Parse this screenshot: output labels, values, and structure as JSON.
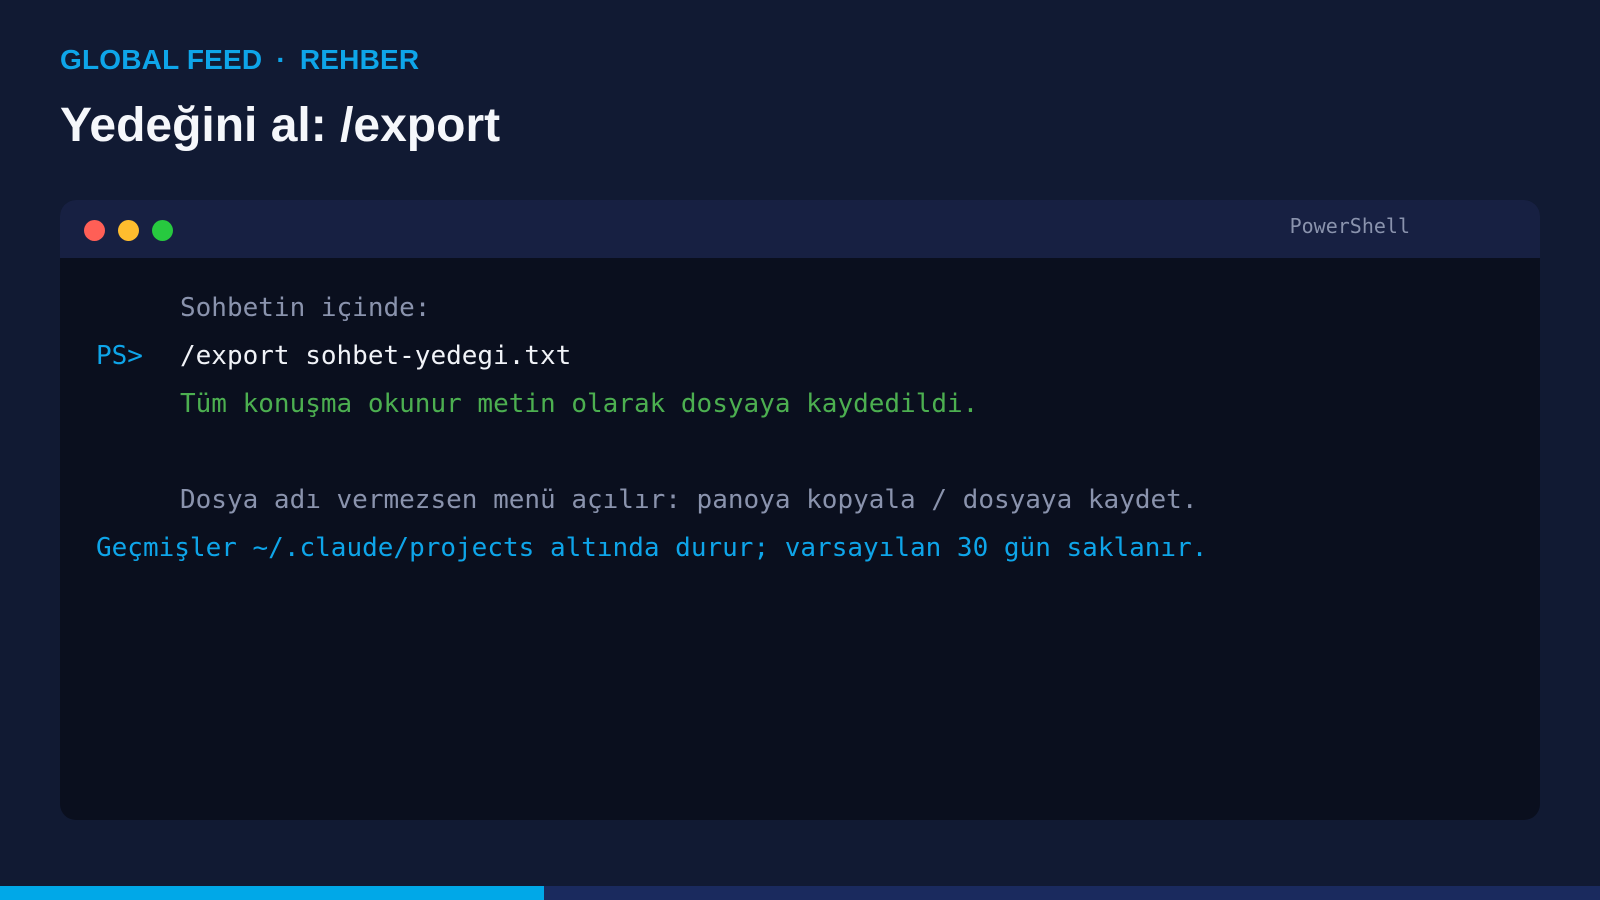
{
  "header": {
    "section": "GLOBAL FEED",
    "separator": "·",
    "category": "REHBER",
    "title": "Yedeğini al: /export"
  },
  "terminal": {
    "title": "PowerShell",
    "prompt": "PS>",
    "lines": [
      {
        "prompt": "",
        "text": "Sohbetin içinde:"
      },
      {
        "prompt": "PS>",
        "text": "/export sohbet-yedegi.txt"
      },
      {
        "prompt": "",
        "text": "Tüm konuşma okunur metin olarak dosyaya kaydedildi."
      },
      {
        "prompt": "",
        "text": ""
      },
      {
        "prompt": "",
        "text": "Dosya adı vermezsen menü açılır: panoya kopyala / dosyaya kaydet."
      },
      {
        "prompt": "",
        "text": "Geçmişler ~/.claude/projects altında durur; varsayılan 30 gün saklanır."
      }
    ]
  },
  "progress": {
    "value": 0.34
  },
  "colors": {
    "background": "#111a33",
    "accent": "#0ea5e9",
    "success": "#4caf50",
    "muted": "#8a93ad",
    "terminal_bg": "#0a0f1e",
    "terminal_bar": "#172042"
  }
}
